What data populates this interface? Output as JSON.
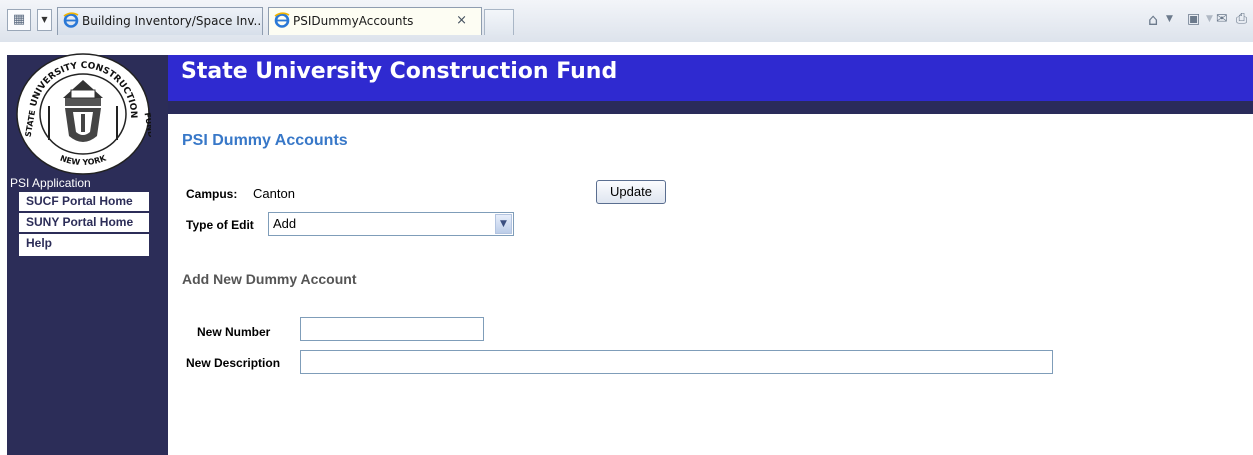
{
  "browser": {
    "tabs": [
      {
        "label": "Building Inventory/Space Inv..."
      },
      {
        "label": "PSIDummyAccounts",
        "close": "×"
      }
    ],
    "quick_tabs_icon": "quick-tabs-icon",
    "tab_list_icon": "chevron-down-icon",
    "command_icons": [
      "home-icon",
      "feeds-icon",
      "mail-icon",
      "print-icon"
    ]
  },
  "site": {
    "title": "State University Construction Fund",
    "seal": {
      "top": "UNIVERSITY CONSTRUCTION",
      "left": "STATE",
      "right": "FUND",
      "bottom": "NEW YORK"
    }
  },
  "sidebar": {
    "app_label": "PSI Application",
    "items": [
      {
        "label": "SUCF Portal Home"
      },
      {
        "label": "SUNY Portal Home"
      },
      {
        "label": "Help"
      }
    ]
  },
  "main": {
    "heading": "PSI Dummy Accounts",
    "campus_label": "Campus:",
    "campus_value": "Canton",
    "update_label": "Update",
    "type_label": "Type of Edit",
    "type_value": "Add",
    "sub_heading": "Add New Dummy Account",
    "new_number_label": "New Number",
    "new_number_value": "",
    "new_description_label": "New Description",
    "new_description_value": ""
  },
  "colors": {
    "header_blue": "#2f2ad0",
    "sidebar_navy": "#2c2d58",
    "heading_blue": "#3878c8"
  }
}
